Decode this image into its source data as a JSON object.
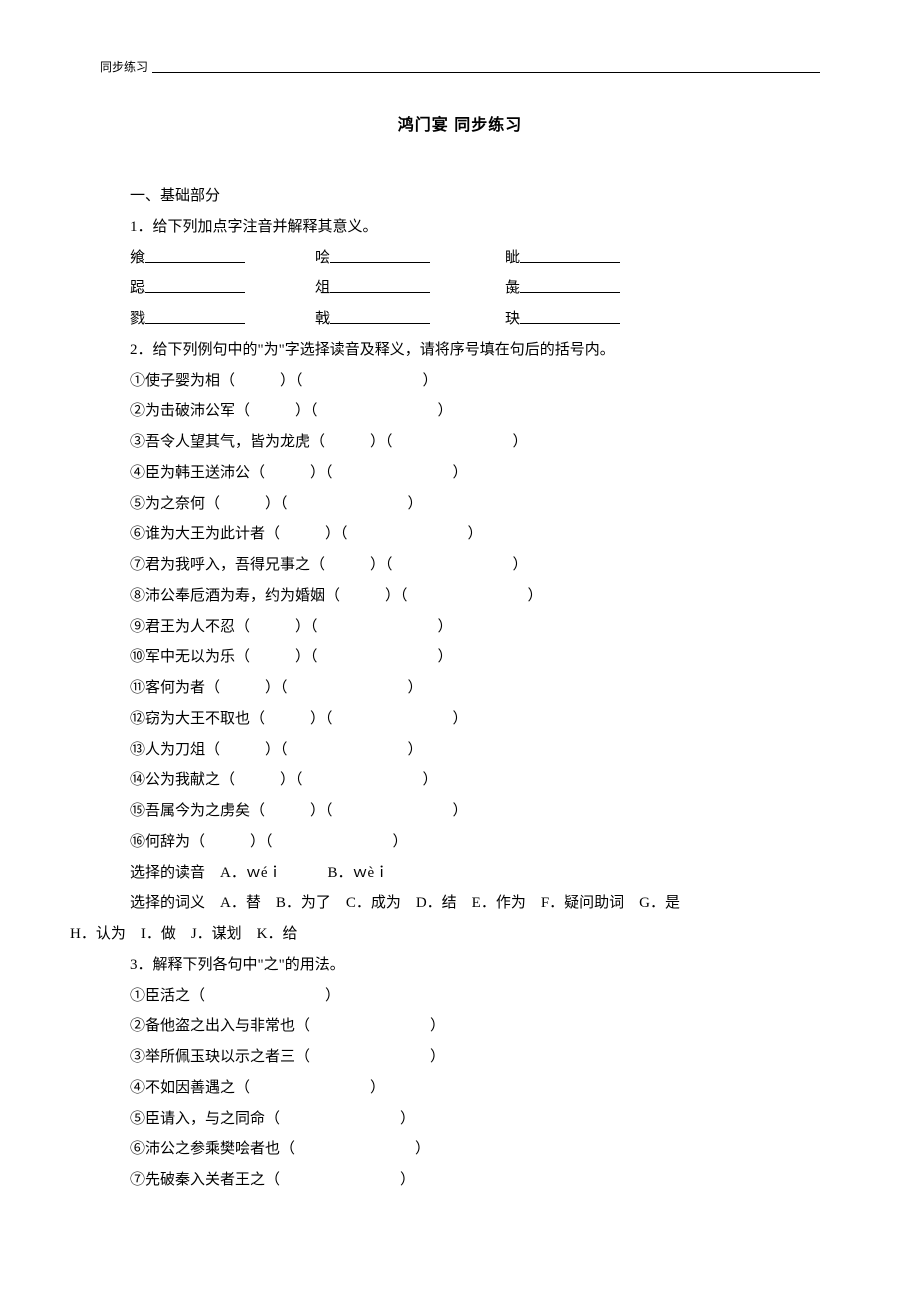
{
  "header_label": "同步练习",
  "title": "鸿门宴  同步练习",
  "sec1_heading": "一、基础部分",
  "q1": {
    "prompt": "1．给下列加点字注音并解释其意义。",
    "row1_c1": "飨",
    "row1_c2": "哙",
    "row1_c3": "眦",
    "row2_c1": "跽",
    "row2_c2": "俎",
    "row2_c3": "彘",
    "row3_c1": "戮",
    "row3_c2": "戟",
    "row3_c3": "玦"
  },
  "q2": {
    "prompt": "2．给下列例句中的\"为\"字选择读音及释义，请将序号填在句后的括号内。",
    "items": [
      "①使子婴为相（　　　）（　　　　　　　　）",
      "②为击破沛公军（　　　）（　　　　　　　　）",
      "③吾令人望其气，皆为龙虎（　　　）（　　　　　　　　）",
      "④臣为韩王送沛公（　　　）（　　　　　　　　）",
      "⑤为之奈何（　　　）（　　　　　　　　）",
      "⑥谁为大王为此计者（　　　）（　　　　　　　　）",
      "⑦君为我呼入，吾得兄事之（　　　）（　　　　　　　　）",
      "⑧沛公奉卮酒为寿，约为婚姻（　　　）（　　　　　　　　）",
      "⑨君王为人不忍（　　　）（　　　　　　　　）",
      "⑩军中无以为乐（　　　）（　　　　　　　　）",
      "⑪客何为者（　　　）（　　　　　　　　）",
      "⑫窃为大王不取也（　　　）（　　　　　　　　）",
      "⑬人为刀俎（　　　）（　　　　　　　　）",
      "⑭公为我献之（　　　）（　　　　　　　　）",
      "⑮吾属今为之虏矣（　　　）（　　　　　　　　）",
      "⑯何辞为（　　　）（　　　　　　　　）"
    ],
    "pron_choices": "选择的读音　A．ｗéｉ　　　B．ｗèｉ",
    "meaning_choices_l1": "选择的词义　A．替　B．为了　C．成为　D．结　E．作为　F．疑问助词　G．是　",
    "meaning_choices_l2": "H．认为　I．做　J．谋划　K．给"
  },
  "q3": {
    "prompt": "3．解释下列各句中\"之\"的用法。",
    "items": [
      "①臣活之（　　　　　　　　）",
      "②备他盗之出入与非常也（　　　　　　　　）",
      "③举所佩玉玦以示之者三（　　　　　　　　）",
      "④不如因善遇之（　　　　　　　　）",
      "⑤臣请入，与之同命（　　　　　　　　）",
      "⑥沛公之参乘樊哙者也（　　　　　　　　）",
      "⑦先破秦入关者王之（　　　　　　　　）"
    ]
  }
}
